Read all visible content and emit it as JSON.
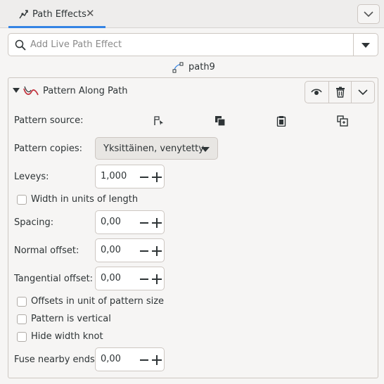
{
  "tab": {
    "label": "Path Effects",
    "close": "✕"
  },
  "search": {
    "placeholder": "Add Live Path Effect"
  },
  "path": {
    "name": "path9"
  },
  "effect": {
    "title": "Pattern Along Path",
    "labels": {
      "pattern_source": "Pattern source:",
      "pattern_copies": "Pattern copies:",
      "width": "Leveys:",
      "spacing": "Spacing:",
      "normal_offset": "Normal offset:",
      "tangential_offset": "Tangential offset:",
      "fuse_nearby_ends": "Fuse nearby ends:"
    },
    "pattern_copies_value": "Yksittäinen, venytetty",
    "values": {
      "width": "1,000",
      "spacing": "0,00",
      "normal_offset": "0,00",
      "tangential_offset": "0,00",
      "fuse_nearby_ends": "0,00"
    },
    "checkboxes": {
      "width_units": "Width in units of length",
      "offsets_unit": "Offsets in unit of pattern size",
      "vertical": "Pattern is vertical",
      "hide_knot": "Hide width knot"
    },
    "source_buttons": [
      "edit-on-canvas-icon",
      "copy-icon",
      "paste-icon",
      "link-icon"
    ]
  },
  "colors": {
    "accent": "#3584e4",
    "effect_icon": "#c3343f"
  }
}
